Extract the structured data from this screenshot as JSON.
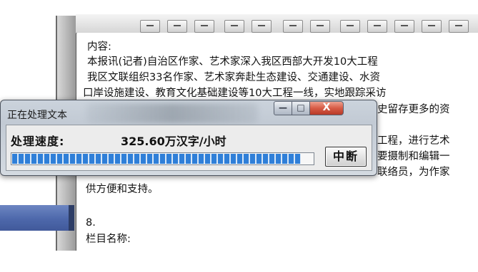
{
  "document": {
    "lines": [
      "内容:",
      "  本报讯(记者)自治区作家、艺术家深入我区西部大开发10大工程",
      "  我区文联组织33名作家、艺术家奔赴生态建设、交通建设、水资",
      "口岸设施建设、教育文化基础建设等10大工程一线，实地跟踪采访",
      "史留存更多的资",
      "工程，进行艺术",
      "要摄制和编辑一",
      "联络员，为作家",
      "供方便和支持。",
      "8.",
      "栏目名称:"
    ]
  },
  "dialog": {
    "title": "正在处理文本",
    "speed_label": "处理速度:",
    "speed_value": "325.60万汉字/小时",
    "progress_fraction": 0.96,
    "stop_label": "中断",
    "minimize_label": "—",
    "maximize_label": "□",
    "close_label": "X"
  },
  "colors": {
    "progress": "#2f7fd8",
    "close_button": "#d75b45",
    "taskbar_strip": "#4d68ab"
  }
}
